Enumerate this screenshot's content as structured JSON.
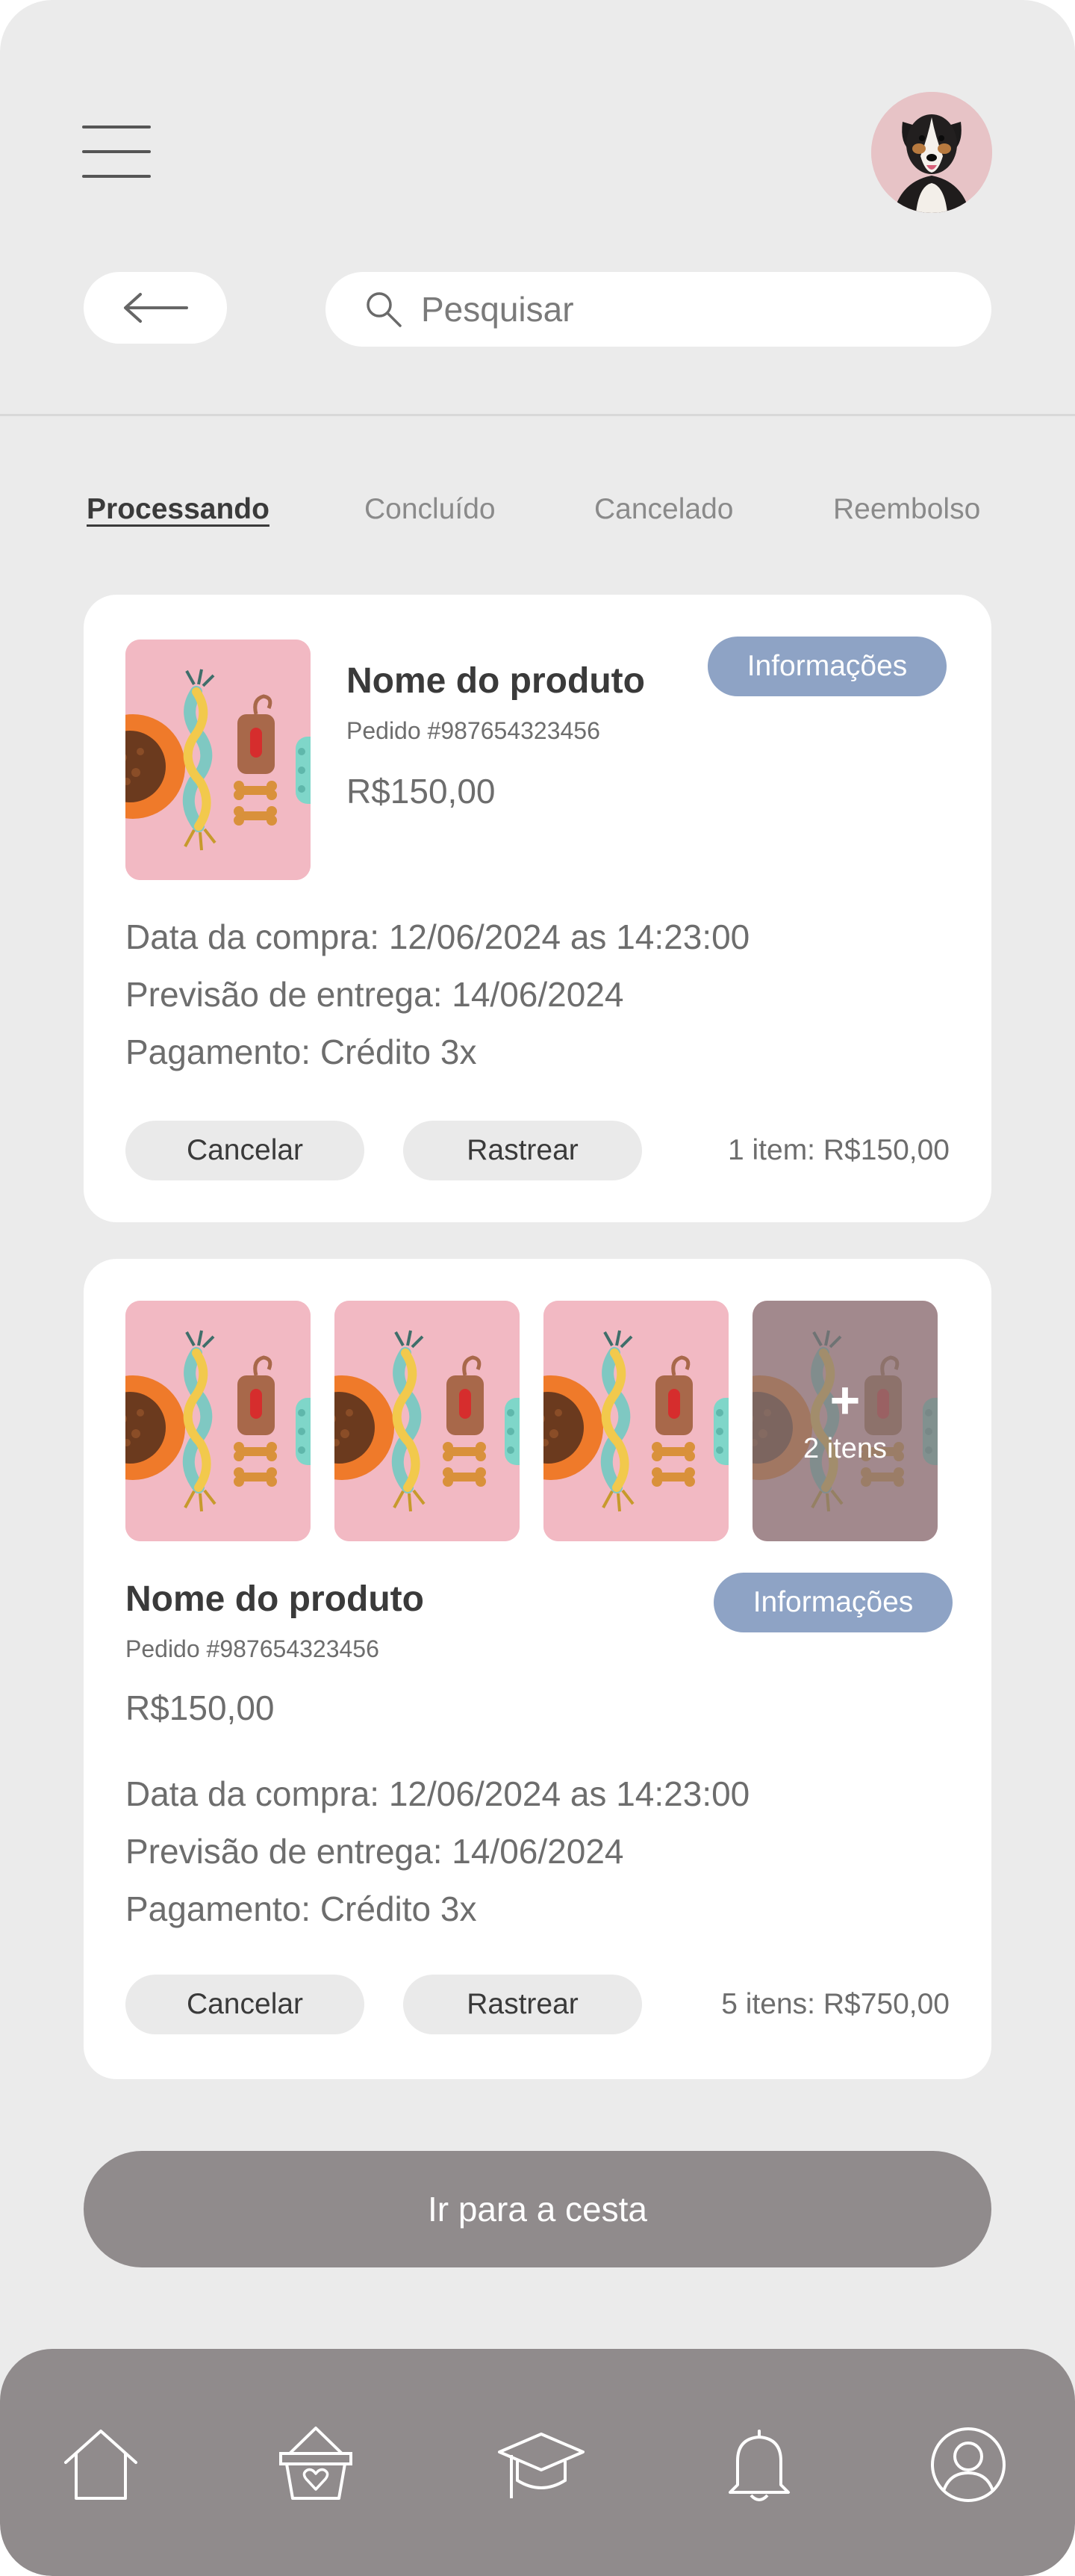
{
  "header": {
    "search_placeholder": "Pesquisar"
  },
  "tabs": [
    {
      "label": "Processando",
      "active": true
    },
    {
      "label": "Concluído",
      "active": false
    },
    {
      "label": "Cancelado",
      "active": false
    },
    {
      "label": "Reembolso",
      "active": false
    }
  ],
  "orders": [
    {
      "name": "Nome do produto",
      "order_number": "Pedido #987654323456",
      "price": "R$150,00",
      "info_label": "Informações",
      "purchase_date": "Data da compra: 12/06/2024 as 14:23:00",
      "delivery_estimate": "Previsão de entrega: 14/06/2024",
      "payment": "Pagamento: Crédito 3x",
      "cancel_label": "Cancelar",
      "track_label": "Rastrear",
      "total": "1 item: R$150,00"
    },
    {
      "name": "Nome do produto",
      "order_number": "Pedido #987654323456",
      "price": "R$150,00",
      "info_label": "Informações",
      "extra_plus": "+",
      "extra_count": "2 itens",
      "purchase_date": "Data da compra: 12/06/2024 as 14:23:00",
      "delivery_estimate": "Previsão de entrega: 14/06/2024",
      "payment": "Pagamento: Crédito 3x",
      "cancel_label": "Cancelar",
      "track_label": "Rastrear",
      "total": "5 itens: R$750,00"
    }
  ],
  "basket_button_label": "Ir para a cesta",
  "bottom_nav": [
    {
      "icon": "home-icon"
    },
    {
      "icon": "basket-icon"
    },
    {
      "icon": "graduation-cap-icon"
    },
    {
      "icon": "bell-icon"
    },
    {
      "icon": "user-icon"
    }
  ],
  "colors": {
    "background": "#ebebeb",
    "card": "#ffffff",
    "accent_info": "#8ea3c5",
    "nav_bar": "#908b8c",
    "product_bg": "#f2b9c3"
  }
}
